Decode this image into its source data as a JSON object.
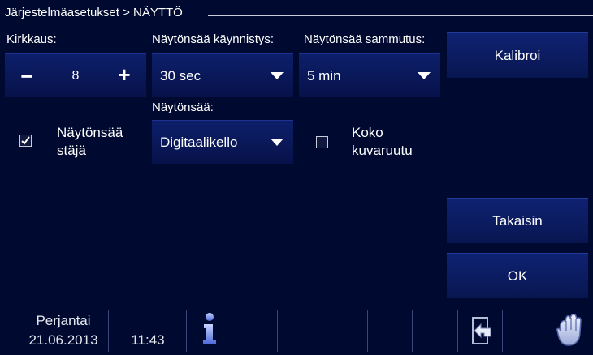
{
  "header": {
    "breadcrumb": "Järjestelmäasetukset > NÄYTTÖ"
  },
  "brightness": {
    "label": "Kirkkaus:",
    "minus": "−",
    "value": "8",
    "plus": "+"
  },
  "screensaver_start": {
    "label": "Näytönsää käynnistys:",
    "value": "30 sec"
  },
  "screensaver_stop": {
    "label": "Näytönsää sammutus:",
    "value": "5 min"
  },
  "screensaver": {
    "label": "Näytönsää:",
    "value": "Digitaalikello"
  },
  "screensaver_setting": {
    "label": "Näytönsäästäjä",
    "checked": true
  },
  "fullscreen": {
    "label": "Koko kuvaruutu",
    "checked": false
  },
  "buttons": {
    "calibrate": "Kalibroi",
    "back": "Takaisin",
    "ok": "OK"
  },
  "footer": {
    "day": "Perjantai",
    "date": "21.06.2013",
    "time": "11:43",
    "info_icon": "info-icon",
    "back_icon": "back-icon",
    "hand_icon": "hand-icon"
  },
  "colors": {
    "background": "#000a30",
    "panel": "#0d1f6a",
    "text": "#ffffff"
  }
}
